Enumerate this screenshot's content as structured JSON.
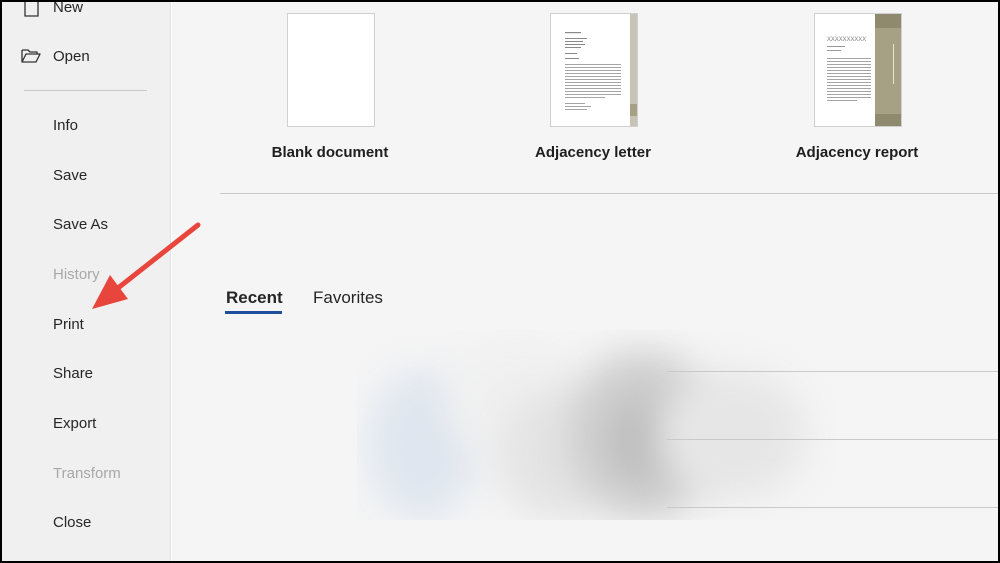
{
  "sidebar": {
    "items": [
      {
        "label": "New",
        "disabled": false,
        "icon": "new-document-icon"
      },
      {
        "label": "Open",
        "disabled": false,
        "icon": "folder-open-icon"
      },
      {
        "label": "Info",
        "disabled": false
      },
      {
        "label": "Save",
        "disabled": false
      },
      {
        "label": "Save As",
        "disabled": false
      },
      {
        "label": "History",
        "disabled": true
      },
      {
        "label": "Print",
        "disabled": false
      },
      {
        "label": "Share",
        "disabled": false
      },
      {
        "label": "Export",
        "disabled": false
      },
      {
        "label": "Transform",
        "disabled": true
      },
      {
        "label": "Close",
        "disabled": false
      }
    ]
  },
  "templates": [
    {
      "label": "Blank document"
    },
    {
      "label": "Adjacency letter"
    },
    {
      "label": "Adjacency report",
      "thumb_title": "XXXXXXXXXX"
    }
  ],
  "tabs": [
    {
      "label": "Recent",
      "active": true
    },
    {
      "label": "Favorites",
      "active": false
    }
  ],
  "colors": {
    "accent": "#1e4e9c",
    "arrow": "#e8453c",
    "template_band": "#a6a084"
  }
}
